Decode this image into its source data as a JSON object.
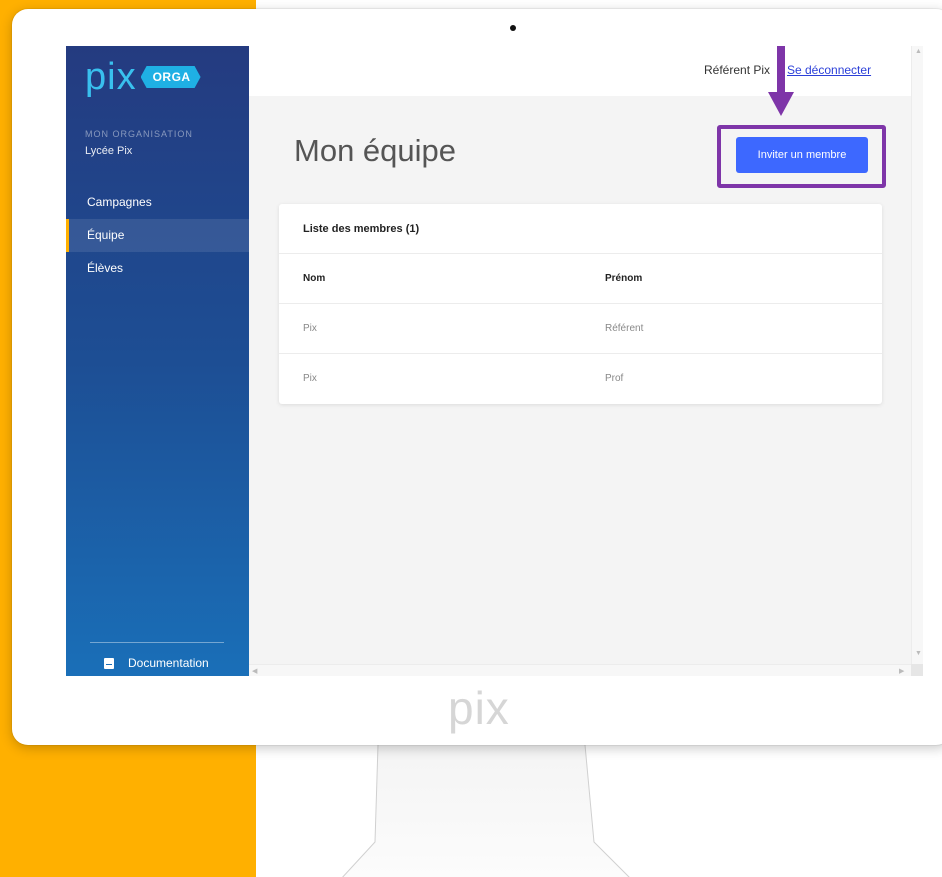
{
  "sidebar": {
    "logo_text": "pix",
    "logo_badge": "ORGA",
    "org_label": "MON ORGANISATION",
    "org_name": "Lycée Pix",
    "nav": [
      {
        "label": "Campagnes",
        "active": false
      },
      {
        "label": "Équipe",
        "active": true
      },
      {
        "label": "Élèves",
        "active": false
      }
    ],
    "documentation_label": "Documentation"
  },
  "header": {
    "user_name": "Référent Pix",
    "logout_label": "Se déconnecter"
  },
  "main": {
    "page_title": "Mon équipe",
    "invite_button_label": "Inviter un membre",
    "members_list": {
      "title": "Liste des membres (1)",
      "columns": [
        "Nom",
        "Prénom"
      ],
      "rows": [
        [
          "Pix",
          "Référent"
        ],
        [
          "Pix",
          "Prof"
        ]
      ]
    }
  },
  "monitor": {
    "brand_text": "pix"
  },
  "colors": {
    "accent": "#3d68ff",
    "highlight": "#7e35a8",
    "sidebar_top": "#243b80",
    "sidebar_bottom": "#1a6fb8",
    "background_accent": "#FFB000",
    "logo": "#39c0ee"
  }
}
